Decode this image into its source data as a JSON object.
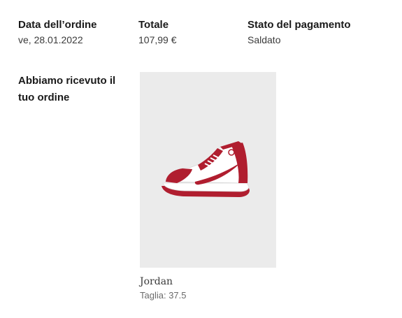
{
  "order_summary": {
    "date": {
      "label": "Data dell’ordine",
      "value": "ve, 28.01.2022"
    },
    "total": {
      "label": "Totale",
      "value": "107,99 €"
    },
    "payment_status": {
      "label": "Stato del pagamento",
      "value": "Saldato"
    }
  },
  "received_heading": "Abbiamo ricevuto il tuo ordine",
  "product": {
    "brand": "Jordan",
    "size_label": "Taglia:",
    "size_value": "37.5",
    "image_icon": "sneaker-icon",
    "colors": {
      "primary": "#b01e2f",
      "secondary": "#ffffff",
      "background": "#ebebeb"
    }
  }
}
